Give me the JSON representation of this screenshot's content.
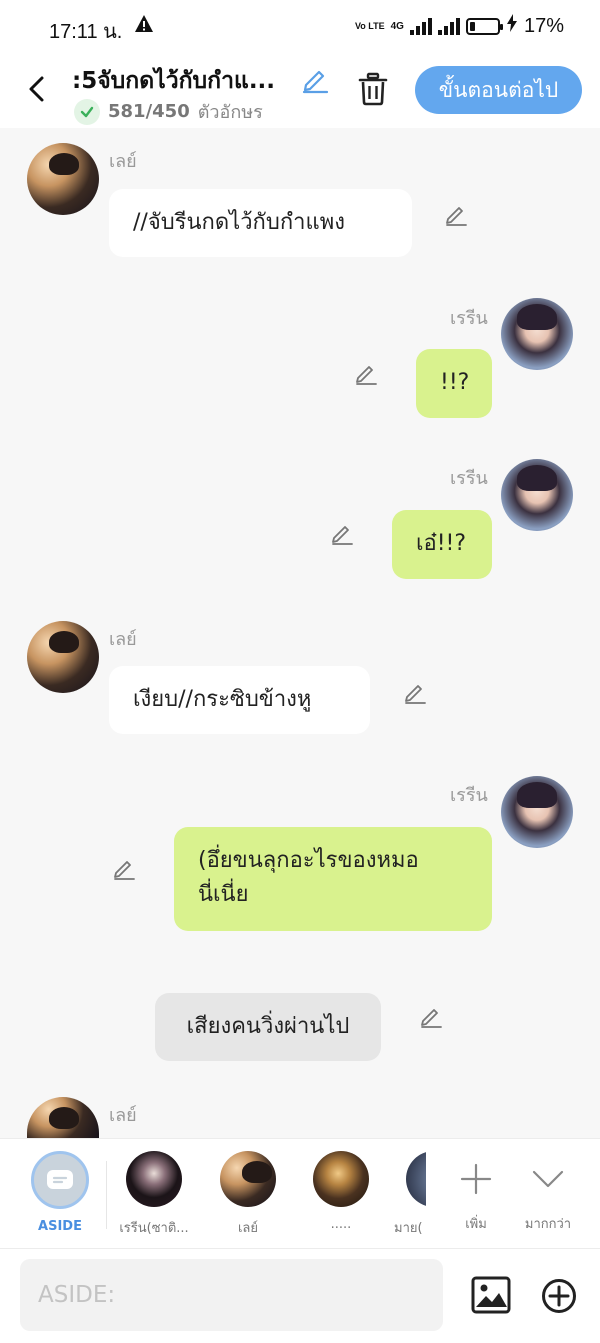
{
  "status_bar": {
    "time": "17:11 น.",
    "battery_percent": "17%",
    "network_label": "4G",
    "volte_label": "Vo LTE"
  },
  "header": {
    "title": ":5จับกดไว้กับกำแ...",
    "char_count": "581/450",
    "char_unit": "ตัวอักษร",
    "next_button": "ขั้นตอนต่อไป"
  },
  "messages": [
    {
      "side": "left",
      "speaker": "เลย์",
      "text": "//จับรีนกดไว้กับกำแพง"
    },
    {
      "side": "right",
      "speaker": "เรรีน",
      "text": "!!?"
    },
    {
      "side": "right",
      "speaker": "เรรีน",
      "text": "เอ๋!!?"
    },
    {
      "side": "left",
      "speaker": "เลย์",
      "text": "เงียบ//กระซิบข้างหู"
    },
    {
      "side": "right",
      "speaker": "เรรีน",
      "text_line1": "(อึ่ยขนลุกอะไรของหมอ",
      "text_line2": "นี่เนี่ย"
    },
    {
      "side": "narration",
      "text": "เสียงคนวิ่งผ่านไป"
    },
    {
      "side": "left",
      "speaker": "เลย์"
    }
  ],
  "character_bar": {
    "aside_label": "ASIDE",
    "char1_label": "เรรีน(ซาติ...",
    "char2_label": "เลย์",
    "char3_label": ".....",
    "char4_label": "มาย(",
    "add_label": "เพิ่ม",
    "more_label": "มากกว่า"
  },
  "input": {
    "placeholder": "ASIDE:"
  },
  "colors": {
    "accent": "#63a7ee",
    "right_bubble": "#d9f28e",
    "left_bubble": "#ffffff",
    "narration_bubble": "#e6e6e6",
    "background": "#f7f7f7"
  }
}
